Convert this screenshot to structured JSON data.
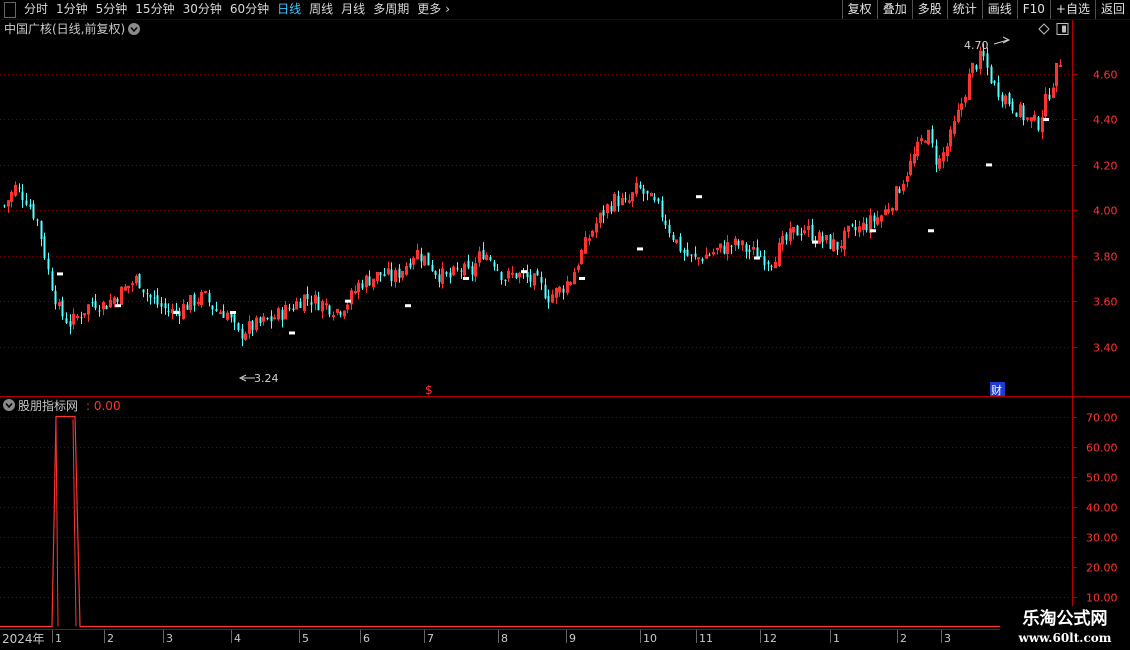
{
  "toolbar": {
    "periods": [
      "分时",
      "1分钟",
      "5分钟",
      "15分钟",
      "30分钟",
      "60分钟",
      "日线",
      "周线",
      "月线",
      "多周期",
      "更多"
    ],
    "active_period": "日线",
    "more_arrow": "›",
    "right_buttons": [
      "复权",
      "叠加",
      "多股",
      "统计",
      "画线",
      "F10",
      "+自选",
      "返回"
    ]
  },
  "main_chart": {
    "title": "中国广核(日线,前复权)",
    "price_ticks": [
      "4.60",
      "4.40",
      "4.20",
      "4.00",
      "3.80",
      "3.60",
      "3.40"
    ],
    "high_label": "4.70",
    "low_label": "3.24",
    "markers": {
      "dividend": "$",
      "finance": "财"
    }
  },
  "indicator": {
    "name": "股朋指标网",
    "value": ": 0.00",
    "ticks": [
      "70.00",
      "60.00",
      "50.00",
      "40.00",
      "30.00",
      "20.00",
      "10.00"
    ]
  },
  "date_axis": {
    "start_label": "2024年",
    "months": [
      "1",
      "2",
      "3",
      "4",
      "5",
      "6",
      "7",
      "8",
      "9",
      "10",
      "11",
      "12",
      "1",
      "2",
      "3"
    ]
  },
  "watermark": {
    "line1": "乐淘公式网",
    "line2": "www.60lt.com"
  },
  "colors": {
    "up": "#ff3232",
    "down": "#54ffff",
    "grid": "#7a0000",
    "axis": "#b40000",
    "text": "#c8c8c8"
  },
  "chart_data": {
    "type": "candlestick",
    "title": "中国广核(日线,前复权)",
    "y_range": [
      3.2,
      4.75
    ],
    "x_range": [
      "2024-01",
      "2025-03"
    ],
    "marked_high": 4.7,
    "marked_low": 3.24,
    "approx_closes": [
      4.02,
      4.1,
      4.05,
      3.95,
      3.72,
      3.55,
      3.5,
      3.55,
      3.6,
      3.58,
      3.62,
      3.66,
      3.7,
      3.62,
      3.58,
      3.55,
      3.57,
      3.6,
      3.62,
      3.56,
      3.55,
      3.45,
      3.48,
      3.5,
      3.52,
      3.55,
      3.58,
      3.62,
      3.6,
      3.58,
      3.56,
      3.6,
      3.68,
      3.7,
      3.72,
      3.7,
      3.75,
      3.82,
      3.78,
      3.72,
      3.7,
      3.74,
      3.72,
      3.82,
      3.78,
      3.7,
      3.72,
      3.7,
      3.68,
      3.62,
      3.65,
      3.7,
      3.82,
      3.92,
      4.0,
      4.05,
      4.02,
      4.1,
      4.05,
      4.0,
      3.9,
      3.82,
      3.78,
      3.8,
      3.82,
      3.84,
      3.85,
      3.82,
      3.8,
      3.78,
      3.85,
      3.9,
      3.92,
      3.88,
      3.86,
      3.84,
      3.9,
      3.92,
      3.95,
      3.98,
      4.05,
      4.15,
      4.25,
      4.35,
      4.2,
      4.3,
      4.45,
      4.62,
      4.68,
      4.55,
      4.5,
      4.45,
      4.4,
      4.38,
      4.52,
      4.66
    ],
    "indicator": {
      "name": "股朋指标网",
      "value": 0.0,
      "y_range": [
        0,
        70
      ],
      "pulse": {
        "month": "1",
        "level": 70
      }
    }
  }
}
